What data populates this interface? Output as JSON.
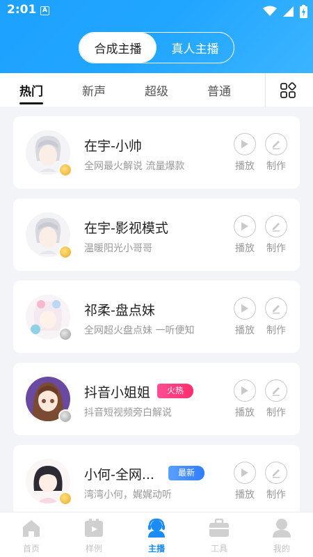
{
  "status_bar": {
    "time": "2:01",
    "notification_glyph": "A"
  },
  "mode_toggle": {
    "options": [
      "合成主播",
      "真人主播"
    ],
    "selected": "合成主播"
  },
  "tabs": [
    {
      "label": "热门",
      "active": true
    },
    {
      "label": "新声",
      "active": false
    },
    {
      "label": "超级",
      "active": false
    },
    {
      "label": "普通",
      "active": false
    }
  ],
  "actions": {
    "play_label": "播放",
    "make_label": "制作"
  },
  "anchors": [
    {
      "name": "在宇-小帅",
      "description": "全网最火解说 流量爆款",
      "medal": "gold",
      "badge": ""
    },
    {
      "name": "在宇-影视模式",
      "description": "温暖阳光小哥哥",
      "medal": "gold",
      "badge": ""
    },
    {
      "name": "祁柔-盘点妹",
      "description": "全网超火盘点妹 一听便知",
      "medal": "silver",
      "badge": ""
    },
    {
      "name": "抖音小姐姐",
      "description": "抖音短视频旁白解说",
      "medal": "silver",
      "badge": "火热"
    },
    {
      "name": "小何-全网...",
      "description": "湾湾小何，娓娓动听",
      "medal": "gold",
      "badge": "最新"
    }
  ],
  "bottom_nav": [
    {
      "label": "首页",
      "icon": "home-icon",
      "active": false
    },
    {
      "label": "样例",
      "icon": "samples-icon",
      "active": false
    },
    {
      "label": "主播",
      "icon": "anchor-icon",
      "active": true
    },
    {
      "label": "工具",
      "icon": "toolbox-icon",
      "active": false
    },
    {
      "label": "我的",
      "icon": "profile-icon",
      "active": false
    }
  ],
  "colors": {
    "accent": "#1b8cf5",
    "header": "#21a6ff",
    "hot_badge": "#ff3d7f",
    "new_badge": "#3a86ff"
  }
}
